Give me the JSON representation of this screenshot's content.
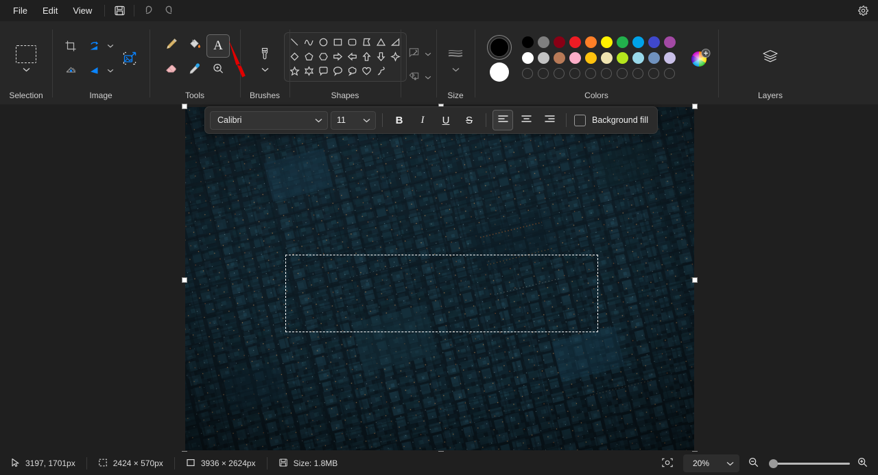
{
  "app": {
    "name": "Paint",
    "theme_bg": "#1f1f1f",
    "accent": "#0a84ff"
  },
  "menubar": {
    "items": [
      {
        "label": "File",
        "name": "menu-file"
      },
      {
        "label": "Edit",
        "name": "menu-edit"
      },
      {
        "label": "View",
        "name": "menu-view"
      }
    ],
    "quick_actions": [
      {
        "icon": "save-icon",
        "name": "save-button"
      },
      {
        "icon": "undo-icon",
        "name": "undo-button"
      },
      {
        "icon": "redo-icon",
        "name": "redo-button"
      }
    ],
    "settings": {
      "icon": "gear-icon",
      "name": "settings-button"
    }
  },
  "ribbon": {
    "groups": [
      {
        "label": "Selection",
        "name": "group-selection"
      },
      {
        "label": "Image",
        "name": "group-image"
      },
      {
        "label": "Tools",
        "name": "group-tools"
      },
      {
        "label": "Brushes",
        "name": "group-brushes"
      },
      {
        "label": "Shapes",
        "name": "group-shapes"
      },
      {
        "label": "Size",
        "name": "group-size"
      },
      {
        "label": "Colors",
        "name": "group-colors"
      },
      {
        "label": "Layers",
        "name": "group-layers"
      }
    ],
    "selection": {
      "tool": "rectangular-selection",
      "has_dropdown": true
    },
    "image": {
      "tools": [
        "crop-icon",
        "rotate-icon",
        "transparent-selection-icon",
        "flip-icon",
        "resize-image-icon"
      ]
    },
    "tools": {
      "items": [
        {
          "name": "pencil-tool",
          "icon": "pencil-icon",
          "active": false
        },
        {
          "name": "fill-tool",
          "icon": "paint-bucket-icon",
          "active": false
        },
        {
          "name": "text-tool",
          "icon": "text-a-icon",
          "active": true
        },
        {
          "name": "eraser-tool",
          "icon": "eraser-icon",
          "active": false
        },
        {
          "name": "color-picker-tool",
          "icon": "eyedropper-icon",
          "active": false
        },
        {
          "name": "magnifier-tool",
          "icon": "magnifier-icon",
          "active": false
        }
      ]
    },
    "brushes": {
      "icon": "brush-icon",
      "has_dropdown": true
    },
    "shapes": {
      "items": [
        "line",
        "curve",
        "oval",
        "rectangle",
        "rounded-rectangle",
        "polygon",
        "triangle",
        "right-triangle",
        "diamond",
        "pentagon",
        "hexagon",
        "right-arrow",
        "left-arrow",
        "up-arrow",
        "down-arrow",
        "four-point-star",
        "five-point-star",
        "six-point-star",
        "rectangular-callout",
        "oval-callout",
        "cloud-callout",
        "heart",
        "lightning"
      ],
      "outline_dropdown": {
        "icon": "outline-icon",
        "name": "shape-outline-dropdown"
      },
      "fill_dropdown": {
        "icon": "fill-icon",
        "name": "shape-fill-dropdown"
      }
    },
    "size": {
      "icon": "size-lines-icon",
      "has_dropdown": true
    },
    "colors": {
      "primary": "#000000",
      "secondary": "#ffffff",
      "row1": [
        "#000000",
        "#7f7f7f",
        "#880015",
        "#ed1c24",
        "#ff7f27",
        "#fff200",
        "#22b14c",
        "#00a2e8",
        "#3f48cc",
        "#a349a4"
      ],
      "row2": [
        "#ffffff",
        "#c3c3c3",
        "#b97a57",
        "#ffaec9",
        "#ffc20e",
        "#efe4b0",
        "#b5e61d",
        "#99d9ea",
        "#7092be",
        "#c8bfe7"
      ],
      "row3_empty_count": 10,
      "edit_colors": {
        "icon": "color-wheel-icon",
        "name": "edit-colors-button"
      }
    },
    "layers": {
      "icon": "layers-icon",
      "name": "layers-button"
    }
  },
  "text_toolbar": {
    "font_family": "Calibri",
    "font_size": "11",
    "bold": "B",
    "italic": "I",
    "underline": "U",
    "strikethrough": "S",
    "align": [
      {
        "name": "align-left-button",
        "active": true
      },
      {
        "name": "align-center-button",
        "active": false
      },
      {
        "name": "align-right-button",
        "active": false
      }
    ],
    "background_fill_label": "Background fill",
    "background_fill_checked": false
  },
  "canvas": {
    "description": "aerial night photo of a dense city grid, dark teal",
    "selection_marquee": true,
    "handles": 8
  },
  "status": {
    "cursor_position": "3197, 1701px",
    "selection_size": "2424 × 570px",
    "image_size": "3936 × 2624px",
    "file_size": "Size: 1.8MB",
    "fit_to_window_icon": "fit-to-window-icon",
    "zoom_level": "20%",
    "zoom_out_icon": "zoom-out-icon",
    "zoom_in_icon": "zoom-in-icon",
    "zoom_slider_percent": 5
  }
}
